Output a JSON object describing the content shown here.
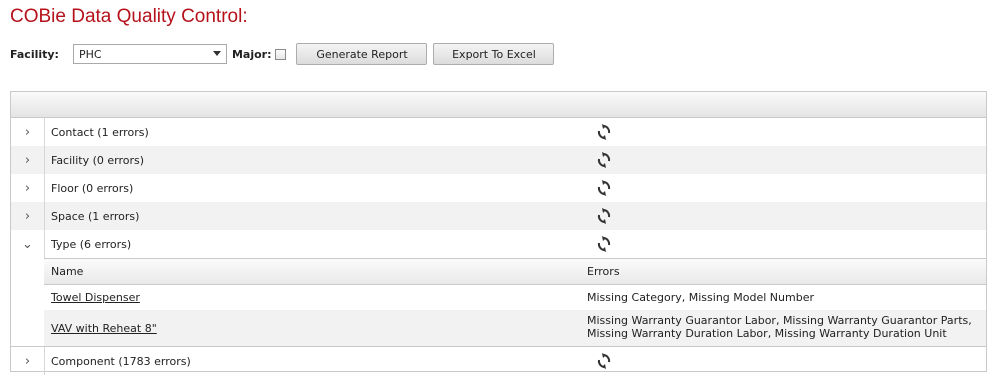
{
  "title": "COBie Data Quality Control:",
  "toolbar": {
    "facility_label": "Facility:",
    "facility_value": "PHC",
    "major_label": "Major:",
    "major_checked": false,
    "generate_label": "Generate Report",
    "export_label": "Export To Excel"
  },
  "grid": {
    "rows": [
      {
        "label": "Contact (1 errors)",
        "expanded": false
      },
      {
        "label": "Facility (0 errors)",
        "expanded": false
      },
      {
        "label": "Floor (0 errors)",
        "expanded": false
      },
      {
        "label": "Space (1 errors)",
        "expanded": false
      },
      {
        "label": "Type (6 errors)",
        "expanded": true
      },
      {
        "label": "Component (1783 errors)",
        "expanded": false
      }
    ],
    "detail": {
      "header_name": "Name",
      "header_errors": "Errors",
      "rows": [
        {
          "name": "Towel Dispenser",
          "errors": "Missing Category, Missing Model Number"
        },
        {
          "name": "VAV with Reheat 8\"",
          "errors": "Missing Warranty Guarantor Labor, Missing Warranty Guarantor Parts, Missing Warranty Duration Labor, Missing Warranty Duration Unit"
        }
      ]
    }
  },
  "icons": {
    "collapsed": "chevron-right-icon",
    "expanded": "chevron-down-icon",
    "refresh": "refresh-icon"
  },
  "colors": {
    "title": "#b5121b"
  }
}
